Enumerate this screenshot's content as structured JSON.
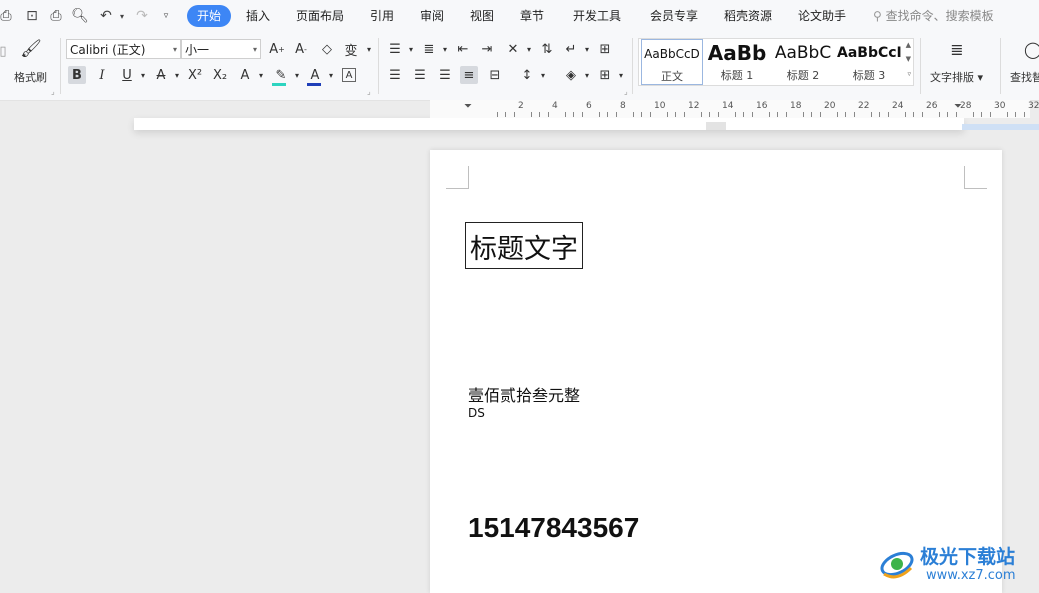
{
  "menu": {
    "tabs": [
      "开始",
      "插入",
      "页面布局",
      "引用",
      "审阅",
      "视图",
      "章节",
      "开发工具",
      "会员专享",
      "稻壳资源",
      "论文助手"
    ],
    "search_placeholder": "查找命令、搜索模板"
  },
  "ribbon": {
    "format_painter": "格式刷",
    "font_name": "Calibri (正文)",
    "font_size": "小一",
    "styles": [
      {
        "preview": "AaBbCcD",
        "name": "正文"
      },
      {
        "preview": "AaBb",
        "name": "标题 1"
      },
      {
        "preview": "AaBbC",
        "name": "标题 2"
      },
      {
        "preview": "AaBbCcI",
        "name": "标题 3"
      }
    ],
    "text_layout": "文字排版",
    "find_replace": "查找替"
  },
  "ruler": {
    "labels": [
      "2",
      "4",
      "6",
      "8",
      "10",
      "12",
      "14",
      "16",
      "18",
      "20",
      "22",
      "24",
      "26",
      "28",
      "30",
      "32"
    ]
  },
  "document": {
    "heading": "标题文字",
    "line1": "壹佰贰拾叁元整",
    "line2": "DS",
    "phone": "15147843567"
  },
  "watermark": {
    "brand": "极光下载站",
    "url": "www.xz7.com"
  },
  "colors": {
    "accent": "#3d86f5",
    "highlight": "#2dd4c0",
    "font_color": "#d6261c"
  }
}
